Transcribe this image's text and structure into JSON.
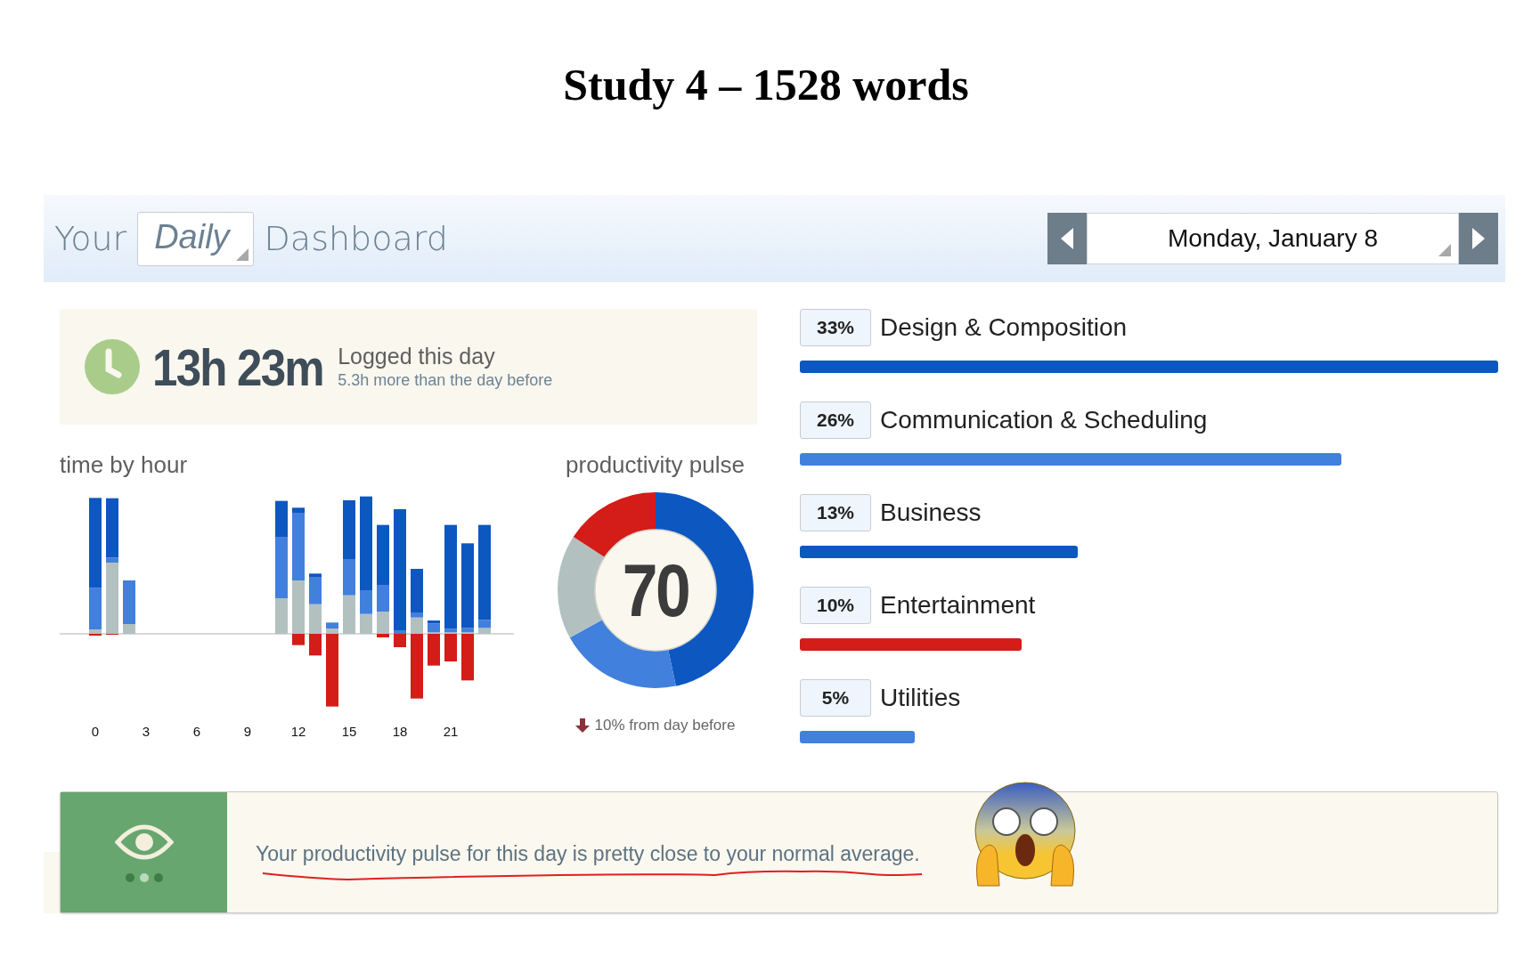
{
  "document_title": "Study 4 – 1528 words",
  "header": {
    "prefix": "Your",
    "period": "Daily",
    "suffix": "Dashboard",
    "date": "Monday, January 8"
  },
  "time_logged": {
    "value": "13h 23m",
    "label": "Logged this day",
    "comparison": "5.3h more than the day before"
  },
  "time_by_hour": {
    "title": "time by hour",
    "hour_labels": [
      "0",
      "3",
      "6",
      "9",
      "12",
      "15",
      "18",
      "21"
    ]
  },
  "productivity_pulse": {
    "title": "productivity pulse",
    "score": "70",
    "change": "10% from day before"
  },
  "categories": [
    {
      "percent": "33%",
      "name": "Design & Composition",
      "level": 1.0,
      "color": "#0d57c1"
    },
    {
      "percent": "26%",
      "name": "Communication & Scheduling",
      "level": 0.775,
      "color": "#4180dc"
    },
    {
      "percent": "13%",
      "name": "Business",
      "level": 0.398,
      "color": "#0d57c1"
    },
    {
      "percent": "10%",
      "name": "Entertainment",
      "level": 0.317,
      "color": "#d41c18"
    },
    {
      "percent": "5%",
      "name": "Utilities",
      "level": 0.165,
      "color": "#4180dc"
    }
  ],
  "insight": {
    "message": "Your productivity pulse for this day is pretty close to your normal average."
  }
}
